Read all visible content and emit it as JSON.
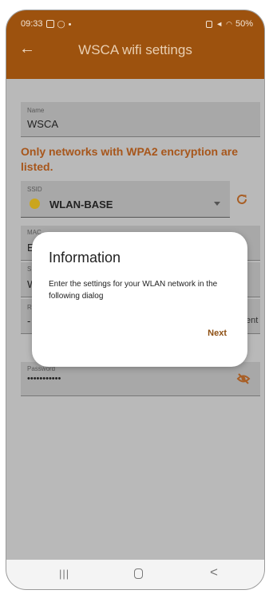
{
  "status_bar": {
    "time": "09:33",
    "battery": "50%"
  },
  "app_bar": {
    "back_icon": "arrow-left-icon",
    "title": "WSCA wifi settings"
  },
  "form": {
    "name_field": {
      "label": "Name",
      "value": "WSCA"
    },
    "warning": "Only networks with WPA2 encryption are listed.",
    "ssid_field": {
      "label": "SSID",
      "value": "WLAN-BASE",
      "icon": "sun-icon"
    },
    "refresh_icon": "refresh-icon",
    "mac_field": {
      "label": "MAC",
      "value": "E"
    },
    "field_s": {
      "label": "S",
      "value": "W"
    },
    "field_r": {
      "label": "R",
      "value": "-"
    },
    "side_text": "ent",
    "password_field": {
      "label": "Password",
      "value": "•••••••••••",
      "toggle_icon": "eye-off-icon"
    }
  },
  "dialog": {
    "title": "Information",
    "body": "Enter the settings for your WLAN network in the following dialog",
    "next_label": "Next"
  },
  "nav_bar": {
    "recent_glyph": "|||",
    "back_glyph": "<"
  },
  "colors": {
    "app_bar": "#9d520e",
    "accent": "#a7561b",
    "overlay": "#b9b9b9"
  }
}
